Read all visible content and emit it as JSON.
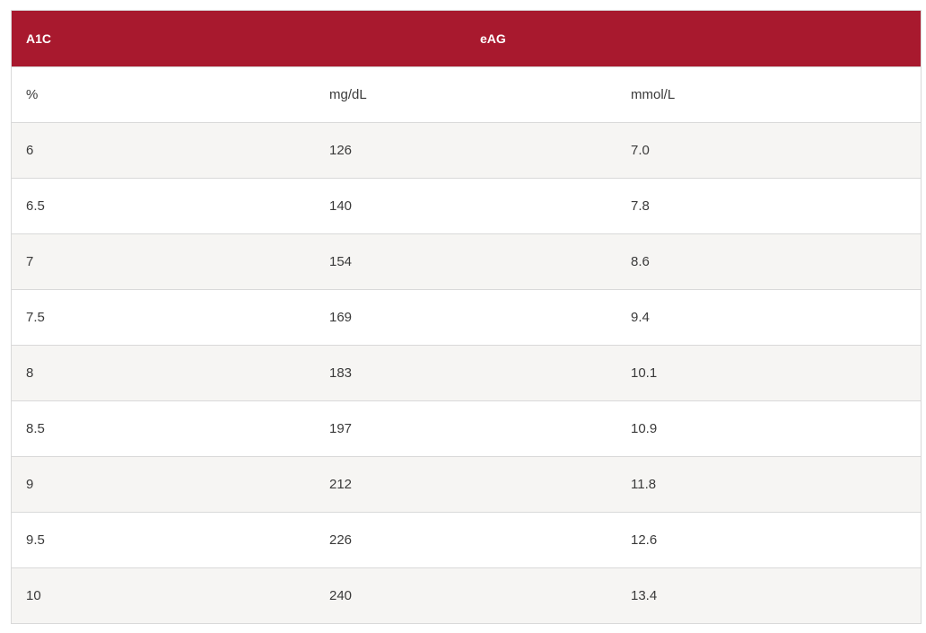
{
  "table": {
    "header": {
      "a1c_label": "A1C",
      "eag_label": "eAG"
    },
    "units": [
      "%",
      "mg/dL",
      "mmol/L"
    ],
    "rows": [
      [
        "6",
        "126",
        "7.0"
      ],
      [
        "6.5",
        "140",
        "7.8"
      ],
      [
        "7",
        "154",
        "8.6"
      ],
      [
        "7.5",
        "169",
        "9.4"
      ],
      [
        "8",
        "183",
        "10.1"
      ],
      [
        "8.5",
        "197",
        "10.9"
      ],
      [
        "9",
        "212",
        "11.8"
      ],
      [
        "9.5",
        "226",
        "12.6"
      ],
      [
        "10",
        "240",
        "13.4"
      ]
    ]
  },
  "colors": {
    "header_bg": "#a8192e",
    "header_text": "#ffffff",
    "row_alt_bg": "#f6f5f3",
    "border": "#d9d9d9",
    "body_text": "#3a3a3a"
  }
}
